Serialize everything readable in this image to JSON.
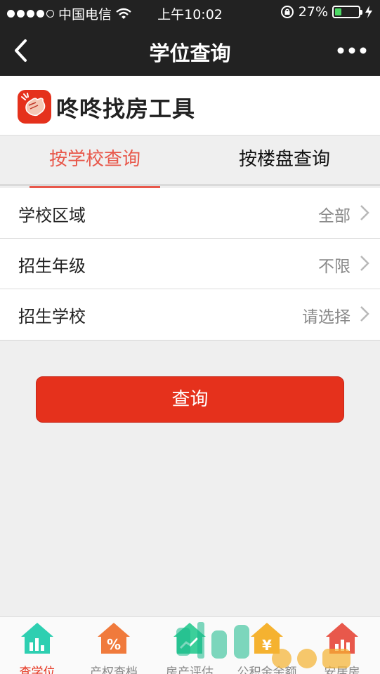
{
  "status": {
    "carrier": "中国电信",
    "time": "上午10:02",
    "battery_pct": "27%",
    "battery_level": 0.27
  },
  "nav": {
    "title": "学位查询",
    "back_icon": "back-arrow-icon",
    "more_icon": "more-dots-icon"
  },
  "brand": {
    "name": "咚咚找房工具"
  },
  "tabs": [
    {
      "label": "按学校查询",
      "active": true
    },
    {
      "label": "按楼盘查询",
      "active": false
    }
  ],
  "filters": [
    {
      "label": "学校区域",
      "value": "全部"
    },
    {
      "label": "招生年级",
      "value": "不限"
    },
    {
      "label": "招生学校",
      "value": "请选择"
    }
  ],
  "query_button": "查询",
  "tabbar": [
    {
      "label": "查学位",
      "icon": "school-house-icon",
      "color": "#2ecfb1",
      "active": true
    },
    {
      "label": "产权查档",
      "icon": "percent-house-icon",
      "color": "#f07a3c",
      "active": false
    },
    {
      "label": "房产评估",
      "icon": "chart-house-icon",
      "color": "#3ccf9a",
      "active": false
    },
    {
      "label": "公积金余额",
      "icon": "yen-house-icon",
      "color": "#f5b230",
      "active": false
    },
    {
      "label": "安居房",
      "icon": "bar-house-icon",
      "color": "#e8584b",
      "active": false
    }
  ],
  "colors": {
    "accent": "#e8584b",
    "button": "#e5311c",
    "bar": "#222222"
  }
}
